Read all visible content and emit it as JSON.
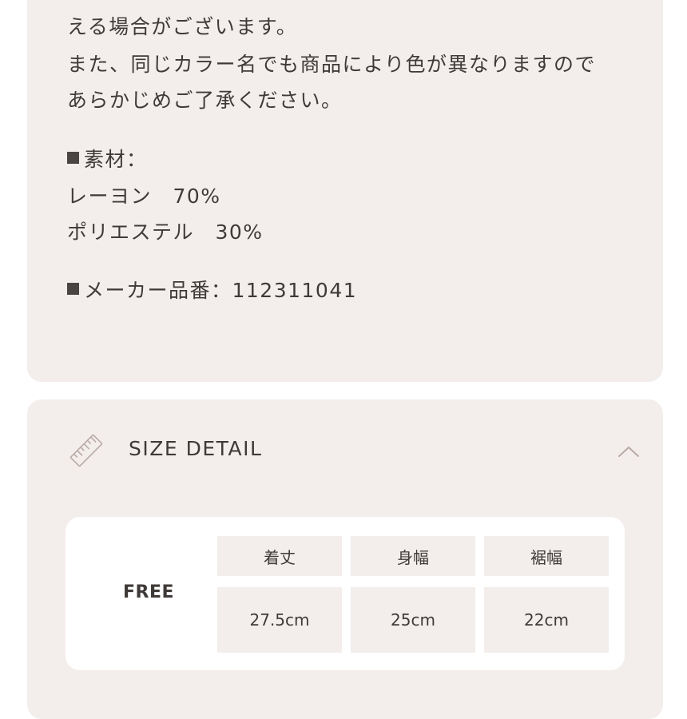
{
  "info": {
    "line1": "える場合がございます。",
    "line2": "また、同じカラー名でも商品により色が異なりますので",
    "line3": "あらかじめご了承ください。",
    "material_heading": "素材：",
    "material_1": "レーヨン　70%",
    "material_2": "ポリエステル　30%",
    "maker_number": "メーカー品番：112311041"
  },
  "size_detail": {
    "title": "SIZE DETAIL",
    "ruler_icon": "ruler-icon",
    "toggle_icon": "chevron-up-icon",
    "size_name": "FREE",
    "columns": [
      "着丈",
      "身幅",
      "裾幅"
    ],
    "values": [
      "27.5cm",
      "25cm",
      "22cm"
    ]
  },
  "colors": {
    "card_background": "#f3eeec",
    "text": "#3f3a38",
    "chevron": "#b9aaa6"
  }
}
